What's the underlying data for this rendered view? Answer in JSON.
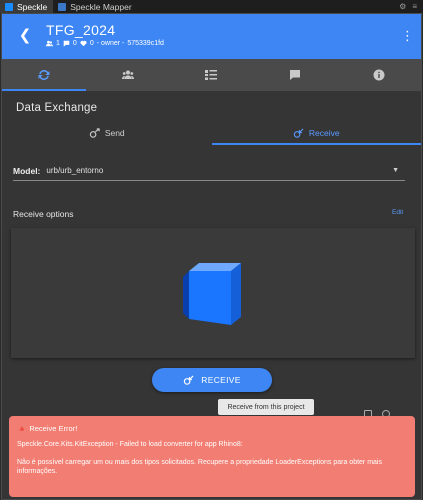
{
  "host_tabs": [
    {
      "label": "Speckle",
      "color": "#1a8cff",
      "active": true
    },
    {
      "label": "Speckle Mapper",
      "color": "#3c78c8",
      "active": false
    }
  ],
  "header": {
    "title": "TFG_2024",
    "meta": {
      "collaborators": "1",
      "comments": "0",
      "likes": "0",
      "owner_text": "- owner -",
      "id": "575339c1fd"
    }
  },
  "nav_tabs": [
    "sync-icon",
    "users-icon",
    "list-icon",
    "comment-icon",
    "info-icon"
  ],
  "data_exchange": {
    "title": "Data Exchange",
    "tabs": [
      {
        "label": "Send",
        "active": false
      },
      {
        "label": "Receive",
        "active": true
      }
    ]
  },
  "model": {
    "label": "Model:",
    "value": "urb/urb_entorno"
  },
  "receive_options": {
    "label": "Receive options",
    "edit": "Edit"
  },
  "receive_button": "RECEIVE",
  "tooltip": "Receive from this project",
  "error": {
    "title": "Receive Error!",
    "line1": "Speckle.Core.Kits.KitException - Failed to load converter for app Rhino8:",
    "line2": "Não é possível carregar um ou mais dos tipos solicitados. Recupere a propriedade LoaderExceptions para obter mais informações."
  },
  "colors": {
    "accent": "#3d86f3",
    "error_bg": "#f27d72",
    "panel_bg": "#353535"
  }
}
